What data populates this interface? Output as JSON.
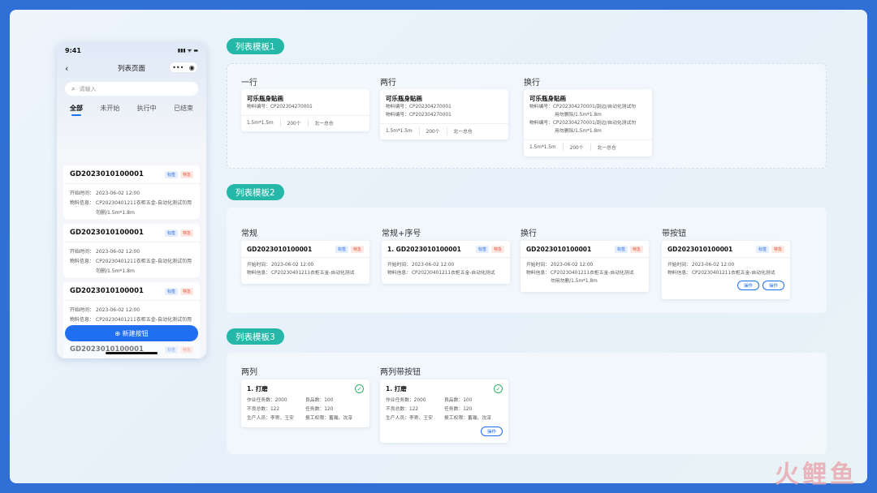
{
  "phone": {
    "time": "9:41",
    "signal": "▮▮▮ ᯤ ▬",
    "back": "‹",
    "title": "列表页面",
    "capsule_more": "•••",
    "capsule_close": "◉",
    "search_placeholder": "请输入",
    "tabs": [
      "全部",
      "未开始",
      "执行中",
      "已结束"
    ],
    "items": [
      {
        "id": "GD2023010100001",
        "tag1": "标签",
        "tag2": "特急",
        "time_k": "开始时间：",
        "time_v": "2023-06-02 12:00",
        "mat_k": "物料信息：",
        "mat_v": "CP20230401211衣柜五金-自动化测试勿用勿删/1.5m*1.8m"
      },
      {
        "id": "GD2023010100001",
        "tag1": "标签",
        "tag2": "特急",
        "time_k": "开始时间：",
        "time_v": "2023-06-02 12:00",
        "mat_k": "物料信息：",
        "mat_v": "CP20230401211衣柜五金-自动化测试勿用勿删/1.5m*1.8m"
      },
      {
        "id": "GD2023010100001",
        "tag1": "标签",
        "tag2": "特急",
        "time_k": "开始时间：",
        "time_v": "2023-06-02 12:00",
        "mat_k": "物料信息：",
        "mat_v": "CP20230401211衣柜五金-自动化测试勿用勿删/1.5m*1.8m"
      },
      {
        "id": "GD2023010100001",
        "tag1": "标签",
        "tag2": "特急"
      }
    ],
    "new_button": "⊕ 新建按钮"
  },
  "sections": {
    "s1": {
      "title": "列表模板1",
      "labels": [
        "一行",
        "两行",
        "换行"
      ],
      "cards": [
        {
          "title": "可乐瓶身贴画",
          "l1": "物料编号：CP202304270001",
          "meta": [
            "1.5m*1.5m",
            "200个",
            "北一总仓"
          ]
        },
        {
          "title": "可乐瓶身贴画",
          "l1": "物料编号：CP202304270001",
          "l2": "物料编号：CP202304270001",
          "meta": [
            "1.5m*1.5m",
            "200个",
            "北一总仓"
          ]
        },
        {
          "title": "可乐瓶身贴画",
          "l1a": "物料编号：CP202304270001/刮边/自动化测试勿",
          "l1b": "用勿删除/1.5m*1.8m",
          "l2a": "物料编号：CP202304270001/刮边/自动化测试勿",
          "l2b": "用勿删除/1.5m*1.8m",
          "meta": [
            "1.5m*1.5m",
            "200个",
            "北一总仓"
          ]
        }
      ]
    },
    "s2": {
      "title": "列表模板2",
      "labels": [
        "常规",
        "常规+序号",
        "换行",
        "带按钮"
      ],
      "tag1": "标签",
      "tag2": "特急",
      "time_k": "开始时间：",
      "time_v": "2023-06-02 12:00",
      "mat_k": "物料信息：",
      "mat_short": "CP20230401211衣柜五金-自动化测试",
      "mat_wrap_a": "CP20230401211衣柜五金-自动化测试",
      "mat_wrap_b": "勿用勿删/1.5m*1.8m",
      "id": "GD2023010100001",
      "id_num": "1. GD2023010100001",
      "btn": "操作"
    },
    "s3": {
      "title": "列表模板3",
      "labels": [
        "两列",
        "两列带按钮"
      ],
      "card_title": "1. 打磨",
      "check": "✓",
      "f": [
        "作业任务数：2000",
        "良品数：100",
        "不良总数：122",
        "任务数：120",
        "生产人员：李寄、王安",
        "报工权限：蓄瀚、沈淳"
      ],
      "btn": "操作"
    }
  },
  "watermark": "火鲤鱼"
}
